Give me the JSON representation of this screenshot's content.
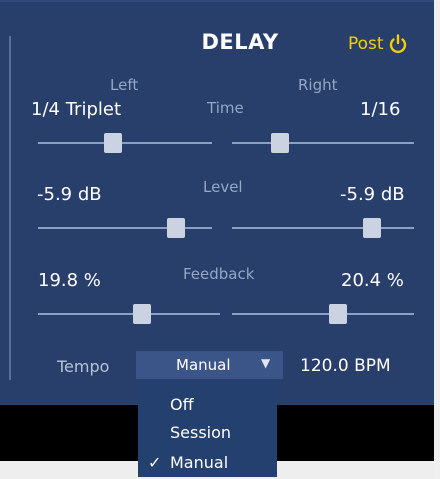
{
  "header": {
    "title": "DELAY",
    "post_label": "Post",
    "power_icon": "power-icon"
  },
  "column_labels": {
    "left": "Left",
    "right": "Right"
  },
  "time": {
    "label": "Time",
    "left_value": "1/4 Triplet",
    "right_value": "1/16",
    "left_slider": 0.42,
    "right_slider": 0.24
  },
  "level": {
    "label": "Level",
    "left_value": "-5.9 dB",
    "right_value": "-5.9 dB",
    "left_slider": 0.83,
    "right_slider": 0.8
  },
  "feedback": {
    "label": "Feedback",
    "left_value": "19.8 %",
    "right_value": "20.4 %",
    "left_slider": 0.58,
    "right_slider": 0.59
  },
  "tempo": {
    "label": "Tempo",
    "mode": "Manual",
    "bpm": "120.0 BPM",
    "options": [
      {
        "label": "Off",
        "checked": false
      },
      {
        "label": "Session",
        "checked": false
      },
      {
        "label": "Manual",
        "checked": true
      }
    ],
    "check_glyph": "✓"
  },
  "colors": {
    "panel": "#283e6b",
    "accent_post": "#f5d000",
    "slider_thumb": "#cbd3e3",
    "menu_bg": "#24406e"
  }
}
